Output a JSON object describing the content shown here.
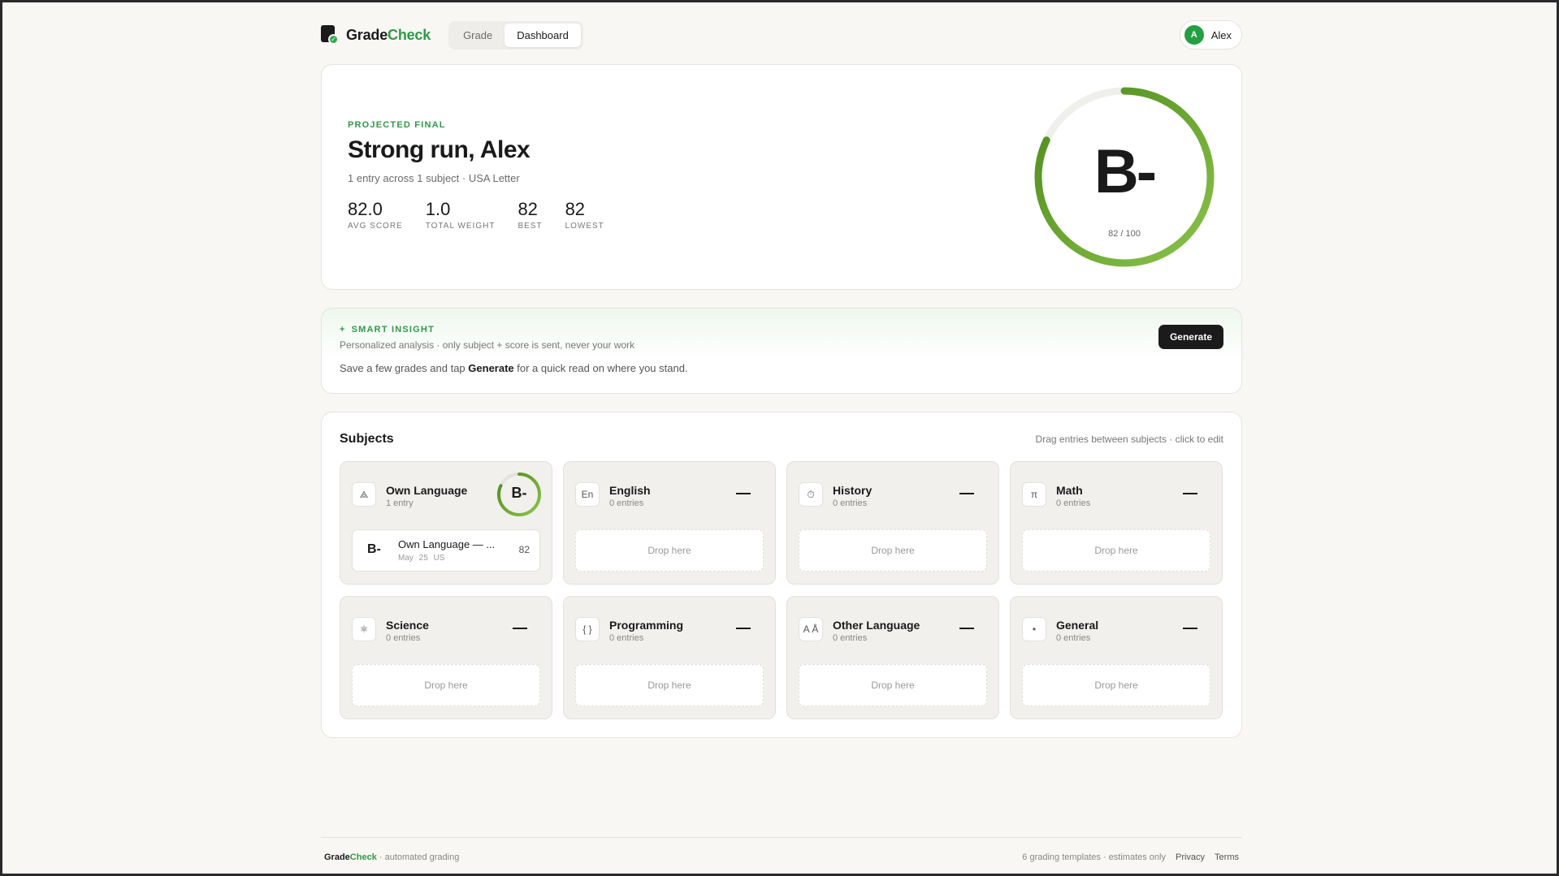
{
  "brand": {
    "part1": "Grade",
    "part2": "Check"
  },
  "nav": {
    "tabs": [
      {
        "label": "Grade"
      },
      {
        "label": "Dashboard"
      }
    ]
  },
  "user": {
    "initial": "A",
    "name": "Alex"
  },
  "hero": {
    "eyebrow": "PROJECTED FINAL",
    "title": "Strong run, Alex",
    "subtitle": "1 entry across 1 subject · USA Letter",
    "stats": [
      {
        "value": "82.0",
        "label": "AVG SCORE"
      },
      {
        "value": "1.0",
        "label": "TOTAL WEIGHT"
      },
      {
        "value": "82",
        "label": "BEST"
      },
      {
        "value": "82",
        "label": "LOWEST"
      }
    ],
    "grade": "B-",
    "score_text": "82 / 100",
    "progress": 0.82
  },
  "insight": {
    "eyebrow": "SMART INSIGHT",
    "sparkle": "+",
    "subtitle": "Personalized analysis · only subject + score is sent, never your work",
    "body_pre": "Save a few grades and tap ",
    "body_bold": "Generate",
    "body_post": " for a quick read on where you stand.",
    "button": "Generate"
  },
  "subjects": {
    "title": "Subjects",
    "hint": "Drag entries between subjects · click to edit",
    "drop_label": "Drop here",
    "items": [
      {
        "name": "Own Language",
        "count": "1 entry",
        "icon": "⟁",
        "grade": "B-",
        "progress": 0.82,
        "entry": {
          "grade": "B-",
          "title": "Own Language — ...",
          "date": "May 25",
          "region": "US",
          "score": "82"
        }
      },
      {
        "name": "English",
        "count": "0 entries",
        "icon": "En"
      },
      {
        "name": "History",
        "count": "0 entries",
        "icon": "⏱"
      },
      {
        "name": "Math",
        "count": "0 entries",
        "icon": "π"
      },
      {
        "name": "Science",
        "count": "0 entries",
        "icon": "⚛"
      },
      {
        "name": "Programming",
        "count": "0 entries",
        "icon": "{ }"
      },
      {
        "name": "Other Language",
        "count": "0 entries",
        "icon": "A Å"
      },
      {
        "name": "General",
        "count": "0 entries",
        "icon": "•"
      }
    ]
  },
  "footer": {
    "tagline": "· automated grading",
    "note": "6 grading templates · estimates only",
    "links": [
      "Privacy",
      "Terms"
    ]
  },
  "colors": {
    "accent": "#2f9a46",
    "ring_start": "#8bc34a",
    "ring_end": "#4c8a1c",
    "track": "#efefec"
  }
}
